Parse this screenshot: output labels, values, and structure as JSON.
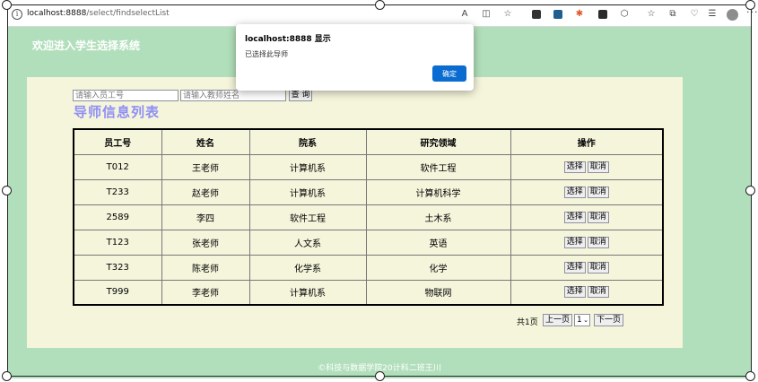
{
  "browser": {
    "url_host": "localhost:8888",
    "url_path": "/select/findselectList"
  },
  "page": {
    "site_title": "欢迎进入学生选择系统",
    "search": {
      "emp_placeholder": "请输入员工号",
      "name_placeholder": "请输入教师姓名",
      "button_label": "查 询"
    },
    "list_title": "导师信息列表",
    "table": {
      "headers": [
        "员工号",
        "姓名",
        "院系",
        "研究领域",
        "操作"
      ],
      "rows": [
        {
          "id": "T012",
          "name": "王老师",
          "dept": "计算机系",
          "field": "软件工程"
        },
        {
          "id": "T233",
          "name": "赵老师",
          "dept": "计算机系",
          "field": "计算机科学"
        },
        {
          "id": "2589",
          "name": "李四",
          "dept": "软件工程",
          "field": "土木系"
        },
        {
          "id": "T123",
          "name": "张老师",
          "dept": "人文系",
          "field": "英语"
        },
        {
          "id": "T323",
          "name": "陈老师",
          "dept": "化学系",
          "field": "化学"
        },
        {
          "id": "T999",
          "name": "李老师",
          "dept": "计算机系",
          "field": "物联网"
        }
      ],
      "select_label": "选择",
      "cancel_label": "取消"
    },
    "pager": {
      "total_label": "共1页",
      "prev_label": "上一页",
      "page_value": "1",
      "next_label": "下一页"
    },
    "footer": "©科技与数据学院20计科二班王川"
  },
  "dialog": {
    "title": "localhost:8888 显示",
    "message": "已选择此导师",
    "ok_label": "确定"
  },
  "colors": {
    "page_bg": "#b2dfbb",
    "content_bg": "#f5f5dc",
    "list_title": "#8f8ff5",
    "dialog_button": "#0a6cd0"
  }
}
